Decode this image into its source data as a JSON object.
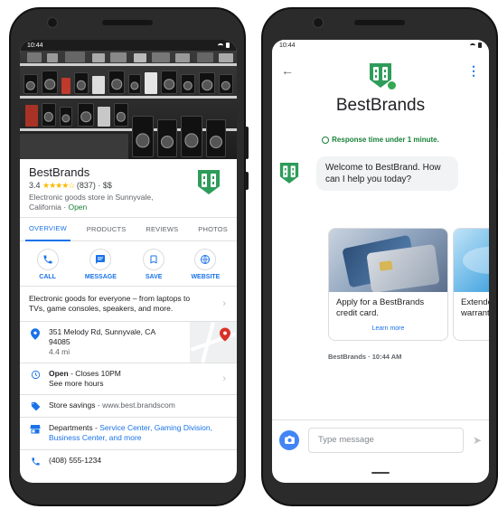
{
  "status_bar": {
    "time": "10:44"
  },
  "listing": {
    "business_name": "BestBrands",
    "rating": "3.4",
    "stars": "★★★★☆",
    "reviews": "(837)",
    "price": "$$",
    "description": "Electronic goods store in Sunnyvale, California",
    "description_sep": " · ",
    "open_status": "Open",
    "tabs": [
      "OVERVIEW",
      "PRODUCTS",
      "REVIEWS",
      "PHOTOS"
    ],
    "actions": [
      {
        "label": "CALL",
        "icon": "phone-icon"
      },
      {
        "label": "MESSAGE",
        "icon": "chat-icon"
      },
      {
        "label": "SAVE",
        "icon": "bookmark-icon"
      },
      {
        "label": "WEBSITE",
        "icon": "globe-icon"
      }
    ],
    "tagline": "Electronic goods for everyone – from laptops to TVs, game consoles, speakers, and more.",
    "address_line1": "351 Melody Rd, Sunnyvale, CA 94085",
    "distance": "4.4 mi",
    "hours_status": "Open",
    "hours_closes": " - Closes 10PM",
    "hours_more": "See more hours",
    "savings_label": "Store savings",
    "savings_sep": " - ",
    "savings_url": "www.best.brandscom",
    "departments_label": "Departments",
    "departments_sep": " - ",
    "departments_list": "Service Center, Gaming Division, Business Center, and more",
    "phone": "(408) 555-1234"
  },
  "chat": {
    "title": "BestBrands",
    "response_time": "Response time under 1 minute.",
    "greeting": "Welcome to BestBrand. How can I help you today?",
    "cards": [
      {
        "title": "Apply for a BestBrands credit card.",
        "link": "Learn more"
      },
      {
        "title": "Extended warranty",
        "link": ""
      }
    ],
    "timestamp": "BestBrands · 10:44 AM",
    "input_placeholder": "Type message"
  },
  "colors": {
    "brand_green": "#2e9c5a",
    "link_blue": "#1a73e8",
    "open_green": "#188038",
    "star_yellow": "#fbbc04"
  }
}
